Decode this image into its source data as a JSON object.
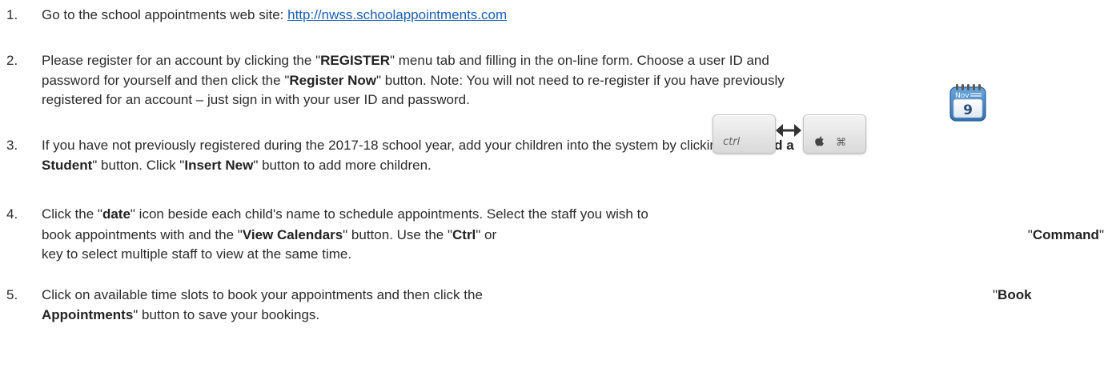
{
  "steps": [
    {
      "number": "1.",
      "lines": [
        {
          "parts": [
            {
              "t": "Go to the school appointments web site:  "
            },
            {
              "t": "http://nwss.schoolappointments.com",
              "link": true
            }
          ]
        }
      ]
    },
    {
      "number": "2.",
      "lines": [
        {
          "parts": [
            {
              "t": "Please register for an account by clicking the \""
            },
            {
              "t": "REGISTER",
              "b": true
            },
            {
              "t": "\" menu tab and filling in the on-line form.  Choose a user ID and"
            }
          ]
        },
        {
          "parts": [
            {
              "t": "password for yourself and then click the \""
            },
            {
              "t": "Register Now",
              "b": true
            },
            {
              "t": "\" button.  Note:  You will not need to re-register if you have previously"
            }
          ]
        },
        {
          "parts": [
            {
              "t": "registered for an account – just sign in with your user ID and password."
            }
          ]
        }
      ]
    },
    {
      "number": "3.",
      "lines": [
        {
          "parts": [
            {
              "t": "If you have not previously registered during the 2017-18 school year, add your children into the system by clicking the \""
            },
            {
              "t": "Add a",
              "b": true
            }
          ]
        },
        {
          "parts": [
            {
              "t": "Student",
              "b": true
            },
            {
              "t": "\" button.  Click \""
            },
            {
              "t": "Insert New",
              "b": true
            },
            {
              "t": "\" button to add more children."
            }
          ]
        }
      ]
    },
    {
      "number": "4.",
      "lines": [
        {
          "parts": [
            {
              "t": "Click the \""
            },
            {
              "t": "date",
              "b": true
            },
            {
              "t": "\" icon beside each child's name to schedule appointments.  Select the staff you wish to"
            }
          ]
        },
        {
          "parts": [
            {
              "t": "book appointments with and the \""
            },
            {
              "t": "View Calendars",
              "b": true
            },
            {
              "t": "\" button.  Use the \""
            },
            {
              "t": "Ctrl",
              "b": true
            },
            {
              "t": "\" or"
            }
          ]
        },
        {
          "parts": [
            {
              "t": "key to select multiple staff to view at the same time."
            }
          ]
        }
      ],
      "trailing": {
        "parts": [
          {
            "t": "\""
          },
          {
            "t": "Command",
            "b": true
          },
          {
            "t": "\""
          }
        ]
      }
    },
    {
      "number": "5.",
      "lines": [
        {
          "parts": [
            {
              "t": "Click on available time slots to book your appointments and then click the"
            }
          ]
        },
        {
          "parts": [
            {
              "t": "Appointments",
              "b": true
            },
            {
              "t": "\" button to save your bookings."
            }
          ]
        }
      ],
      "trailing": {
        "parts": [
          {
            "t": "\""
          },
          {
            "t": "Book",
            "b": true
          }
        ]
      }
    }
  ],
  "icons": {
    "calendar": {
      "name": "calendar-date-icon",
      "month": "Nov",
      "day": "9"
    },
    "ctrl_key": {
      "name": "ctrl-key-icon",
      "label": "ctrl"
    },
    "command_key": {
      "name": "command-key-icon",
      "glyphs": "⌘"
    },
    "arrow": {
      "name": "double-arrow-icon"
    }
  },
  "colors": {
    "link": "#1a5fb4",
    "text": "#2b2b2b",
    "calendar_blue": "#3a7fc1"
  }
}
